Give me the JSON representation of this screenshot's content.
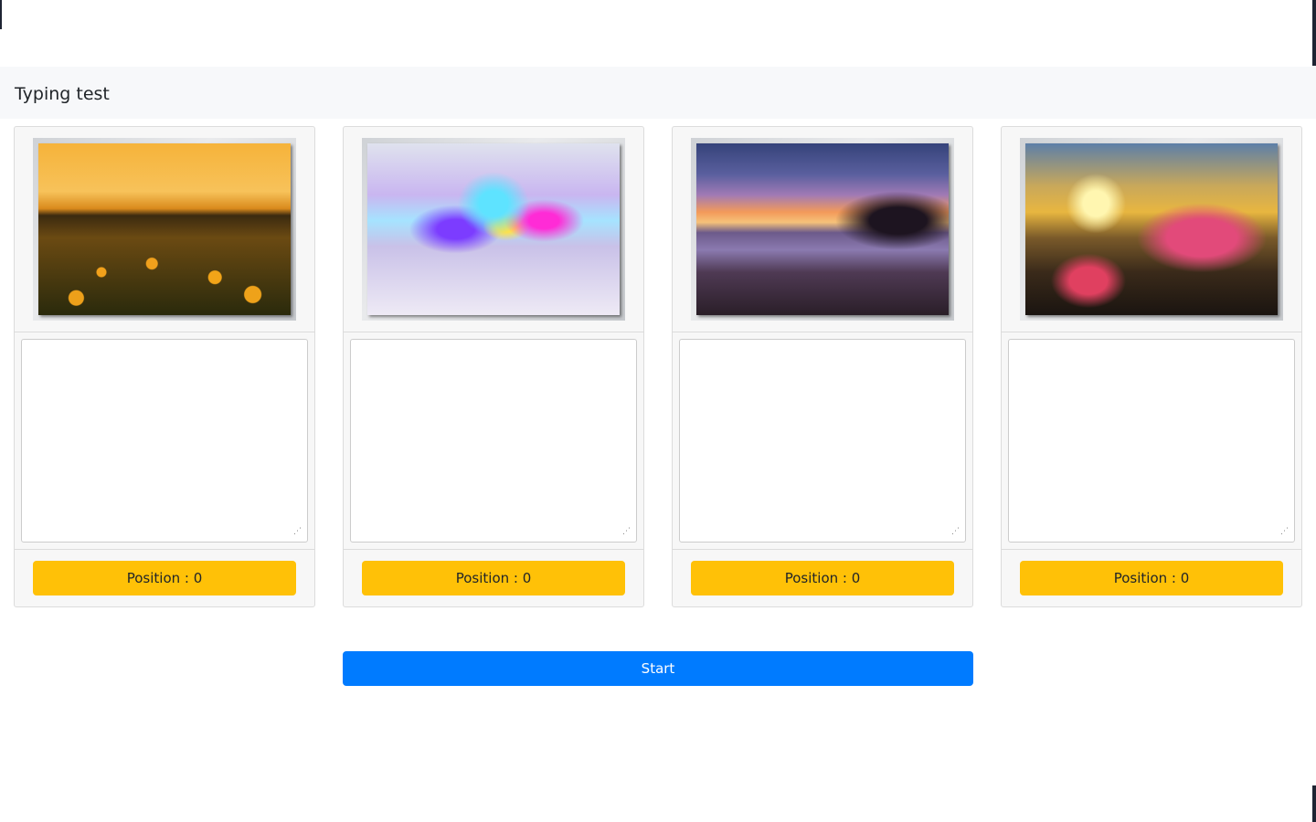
{
  "page": {
    "title": "Typing test"
  },
  "cards": [
    {
      "image": "sunflower-field-sunset-image",
      "position_label": "Position : 0",
      "text_value": ""
    },
    {
      "image": "abstract-rainbow-explosion-image",
      "position_label": "Position : 0",
      "text_value": ""
    },
    {
      "image": "tropical-beach-sunset-image",
      "position_label": "Position : 0",
      "text_value": ""
    },
    {
      "image": "canal-bicycle-flowers-sunset-image",
      "position_label": "Position : 0",
      "text_value": ""
    }
  ],
  "actions": {
    "start_label": "Start"
  },
  "colors": {
    "position_button": "#ffc107",
    "start_button": "#007bff",
    "title_bar": "#f7f8fa"
  }
}
